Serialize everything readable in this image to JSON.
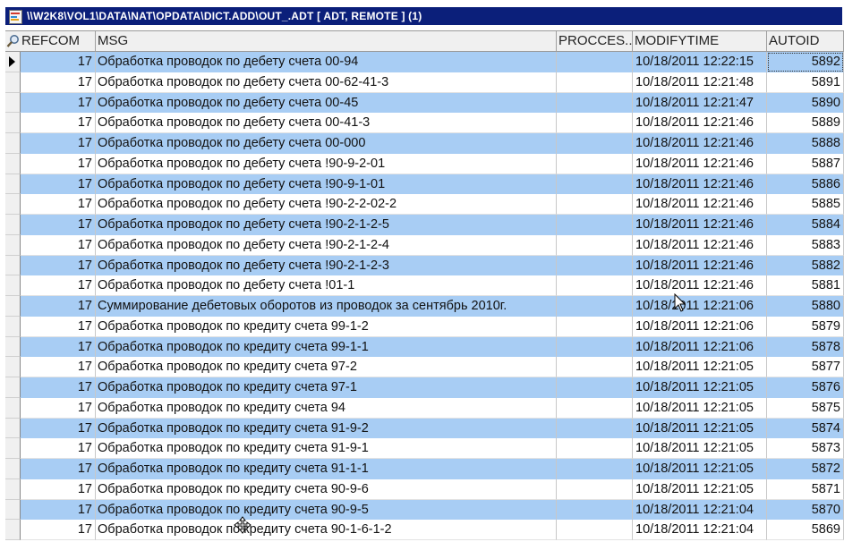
{
  "window": {
    "title": "\\\\W2K8\\VOL1\\DATA\\NAT\\OPDATA\\DICT.ADD\\OUT_.ADT [ ADT, REMOTE ] (1)",
    "icon": "table-document-icon"
  },
  "columns": {
    "refcom": "REFCOM",
    "msg": "MSG",
    "procces": "PROCCES...",
    "modifytime": "MODIFYTIME",
    "autoid": "AUTOID"
  },
  "rows": [
    {
      "refcom": "17",
      "msg": "Обработка проводок по дебету счета 00-94",
      "procces": "",
      "modifytime": "10/18/2011 12:22:15",
      "autoid": "5892"
    },
    {
      "refcom": "17",
      "msg": "Обработка проводок по дебету счета 00-62-41-3",
      "procces": "",
      "modifytime": "10/18/2011 12:21:48",
      "autoid": "5891"
    },
    {
      "refcom": "17",
      "msg": "Обработка проводок по дебету счета 00-45",
      "procces": "",
      "modifytime": "10/18/2011 12:21:47",
      "autoid": "5890"
    },
    {
      "refcom": "17",
      "msg": "Обработка проводок по дебету счета 00-41-3",
      "procces": "",
      "modifytime": "10/18/2011 12:21:46",
      "autoid": "5889"
    },
    {
      "refcom": "17",
      "msg": "Обработка проводок по дебету счета 00-000",
      "procces": "",
      "modifytime": "10/18/2011 12:21:46",
      "autoid": "5888"
    },
    {
      "refcom": "17",
      "msg": "Обработка проводок по дебету счета !90-9-2-01",
      "procces": "",
      "modifytime": "10/18/2011 12:21:46",
      "autoid": "5887"
    },
    {
      "refcom": "17",
      "msg": "Обработка проводок по дебету счета !90-9-1-01",
      "procces": "",
      "modifytime": "10/18/2011 12:21:46",
      "autoid": "5886"
    },
    {
      "refcom": "17",
      "msg": "Обработка проводок по дебету счета !90-2-2-02-2",
      "procces": "",
      "modifytime": "10/18/2011 12:21:46",
      "autoid": "5885"
    },
    {
      "refcom": "17",
      "msg": "Обработка проводок по дебету счета !90-2-1-2-5",
      "procces": "",
      "modifytime": "10/18/2011 12:21:46",
      "autoid": "5884"
    },
    {
      "refcom": "17",
      "msg": "Обработка проводок по дебету счета !90-2-1-2-4",
      "procces": "",
      "modifytime": "10/18/2011 12:21:46",
      "autoid": "5883"
    },
    {
      "refcom": "17",
      "msg": "Обработка проводок по дебету счета !90-2-1-2-3",
      "procces": "",
      "modifytime": "10/18/2011 12:21:46",
      "autoid": "5882"
    },
    {
      "refcom": "17",
      "msg": "Обработка проводок по дебету счета !01-1",
      "procces": "",
      "modifytime": "10/18/2011 12:21:46",
      "autoid": "5881"
    },
    {
      "refcom": "17",
      "msg": "Суммирование дебетовых оборотов из проводок за сентябрь 2010г.",
      "procces": "",
      "modifytime": "10/18/2011 12:21:06",
      "autoid": "5880"
    },
    {
      "refcom": "17",
      "msg": "Обработка проводок по кредиту счета 99-1-2",
      "procces": "",
      "modifytime": "10/18/2011 12:21:06",
      "autoid": "5879"
    },
    {
      "refcom": "17",
      "msg": "Обработка проводок по кредиту счета 99-1-1",
      "procces": "",
      "modifytime": "10/18/2011 12:21:06",
      "autoid": "5878"
    },
    {
      "refcom": "17",
      "msg": "Обработка проводок по кредиту счета 97-2",
      "procces": "",
      "modifytime": "10/18/2011 12:21:05",
      "autoid": "5877"
    },
    {
      "refcom": "17",
      "msg": "Обработка проводок по кредиту счета 97-1",
      "procces": "",
      "modifytime": "10/18/2011 12:21:05",
      "autoid": "5876"
    },
    {
      "refcom": "17",
      "msg": "Обработка проводок по кредиту счета 94",
      "procces": "",
      "modifytime": "10/18/2011 12:21:05",
      "autoid": "5875"
    },
    {
      "refcom": "17",
      "msg": "Обработка проводок по кредиту счета 91-9-2",
      "procces": "",
      "modifytime": "10/18/2011 12:21:05",
      "autoid": "5874"
    },
    {
      "refcom": "17",
      "msg": "Обработка проводок по кредиту счета 91-9-1",
      "procces": "",
      "modifytime": "10/18/2011 12:21:05",
      "autoid": "5873"
    },
    {
      "refcom": "17",
      "msg": "Обработка проводок по кредиту счета 91-1-1",
      "procces": "",
      "modifytime": "10/18/2011 12:21:05",
      "autoid": "5872"
    },
    {
      "refcom": "17",
      "msg": "Обработка проводок по кредиту счета 90-9-6",
      "procces": "",
      "modifytime": "10/18/2011 12:21:05",
      "autoid": "5871"
    },
    {
      "refcom": "17",
      "msg": "Обработка проводок по кредиту счета 90-9-5",
      "procces": "",
      "modifytime": "10/18/2011 12:21:04",
      "autoid": "5870"
    },
    {
      "refcom": "17",
      "msg": "Обработка проводок по кредиту счета 90-1-6-1-2",
      "procces": "",
      "modifytime": "10/18/2011 12:21:04",
      "autoid": "5869"
    }
  ],
  "current_row": 0,
  "colors": {
    "title_bar": "#0b1f7a",
    "alt_row": "#a8cdf4",
    "header_bg": "#f0f0f0"
  }
}
